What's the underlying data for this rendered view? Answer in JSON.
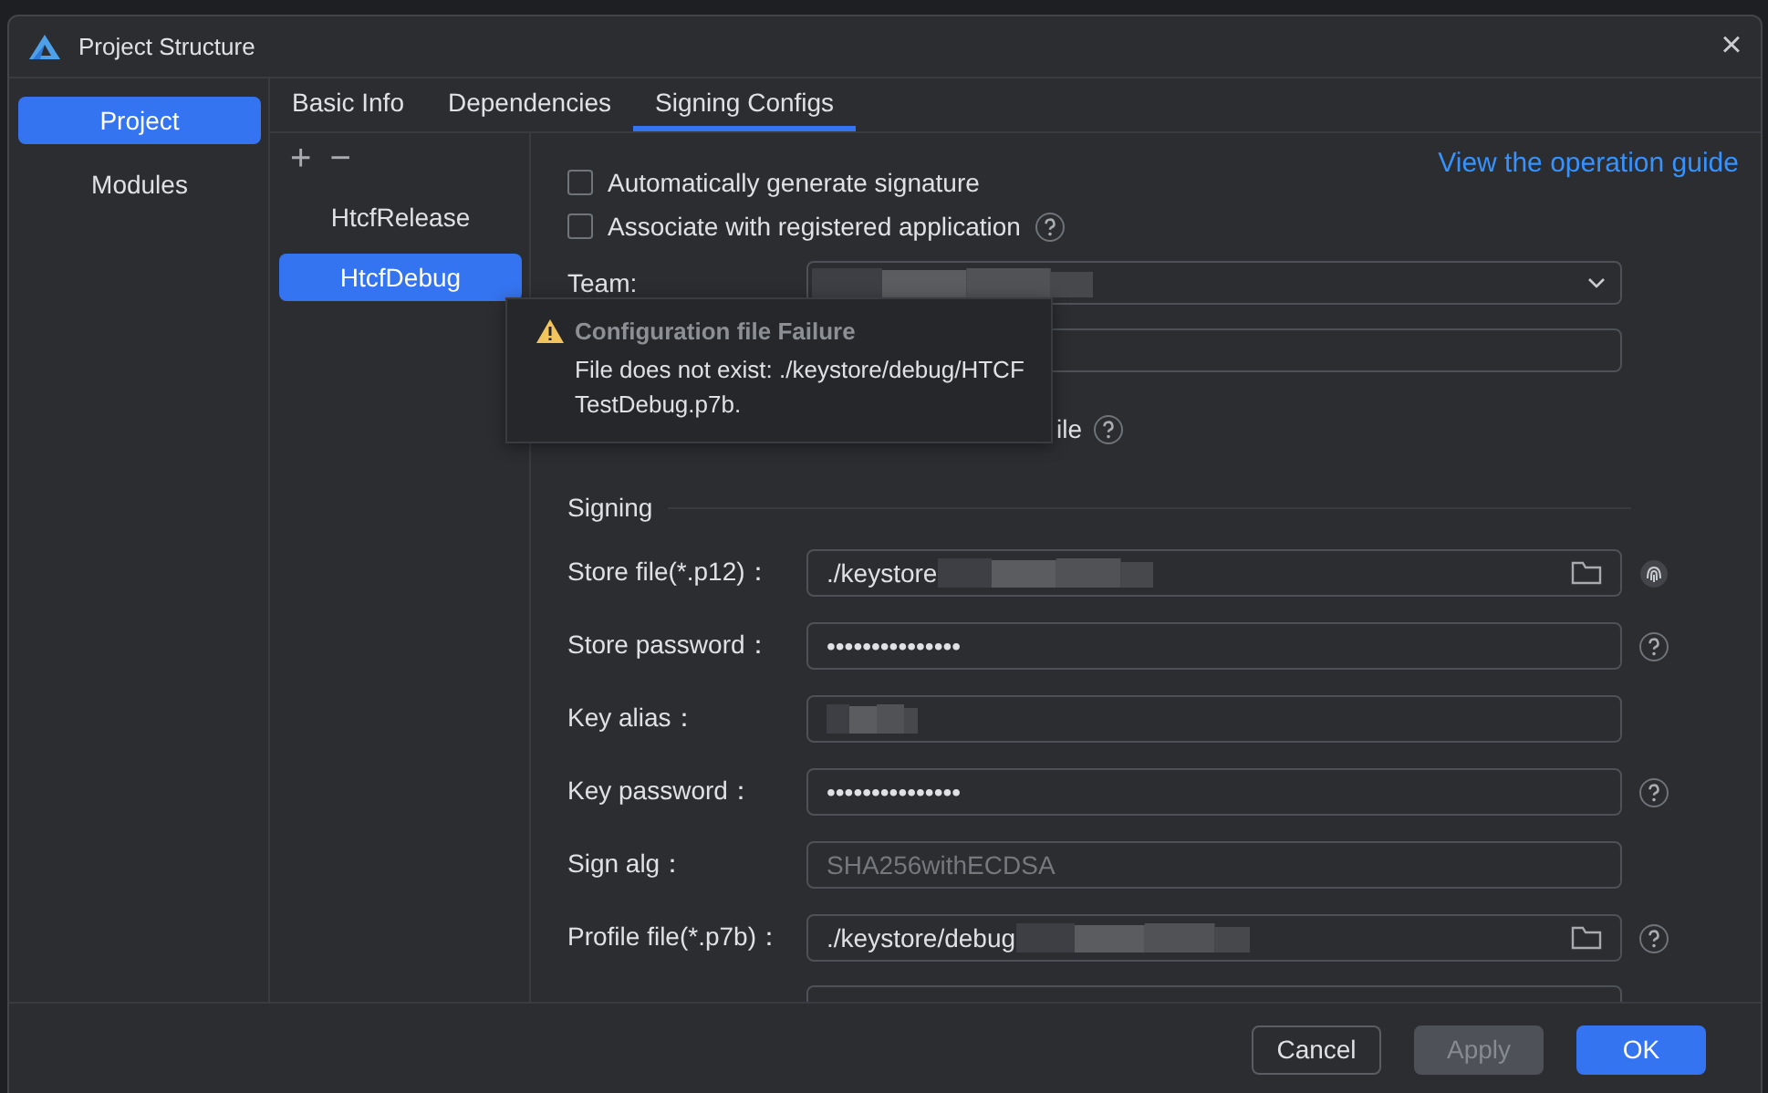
{
  "window": {
    "title": "Project Structure",
    "close": "×"
  },
  "sidebar": {
    "items": [
      {
        "label": "Project",
        "selected": true
      },
      {
        "label": "Modules",
        "selected": false
      }
    ]
  },
  "tabs": [
    {
      "label": "Basic Info",
      "selected": false
    },
    {
      "label": "Dependencies",
      "selected": false
    },
    {
      "label": "Signing Configs",
      "selected": true
    }
  ],
  "config_list": {
    "add": "+",
    "remove": "−",
    "items": [
      {
        "label": "HtcfRelease",
        "selected": false
      },
      {
        "label": "HtcfDebug",
        "selected": true
      }
    ]
  },
  "options": [
    {
      "label": "Automatically generate signature",
      "checked": false,
      "help": false
    },
    {
      "label": "Associate with registered application",
      "checked": false,
      "help": true
    }
  ],
  "guide_link": "View the operation guide",
  "team": {
    "label": "Team:",
    "redacted": true
  },
  "partial_row": {
    "label": "ile",
    "help": true
  },
  "signing": {
    "title": "Signing",
    "fields": [
      {
        "label": "Store file(*.p12)：",
        "value": "./keystore",
        "kind": "file",
        "redacted": true,
        "disabled": false,
        "fingerprint": true,
        "help": false
      },
      {
        "label": "Store password：",
        "value": "•••••••••••••••",
        "kind": "text",
        "redacted": false,
        "disabled": false,
        "fingerprint": false,
        "help": true
      },
      {
        "label": "Key alias：",
        "kind": "text",
        "redacted": true,
        "disabled": false,
        "fingerprint": false,
        "help": false
      },
      {
        "label": "Key password：",
        "value": "•••••••••••••••",
        "kind": "text",
        "redacted": false,
        "disabled": false,
        "fingerprint": false,
        "help": true
      },
      {
        "label": "Sign alg：",
        "value": "SHA256withECDSA",
        "kind": "text",
        "redacted": false,
        "disabled": true,
        "fingerprint": false,
        "help": false
      },
      {
        "label": "Profile file(*.p7b)：",
        "value": "./keystore/debug",
        "kind": "file",
        "redacted": true,
        "disabled": false,
        "fingerprint": false,
        "help": true
      }
    ]
  },
  "tooltip": {
    "title": "Configuration file Failure",
    "lines": [
      "File does not exist: ./keystore/debug/HTCF",
      "TestDebug.p7b."
    ]
  },
  "buttons": [
    {
      "label": "Cancel",
      "kind": "secondary",
      "disabled": false
    },
    {
      "label": "Apply",
      "kind": "secondary",
      "disabled": true
    },
    {
      "label": "OK",
      "kind": "primary",
      "disabled": false
    }
  ]
}
